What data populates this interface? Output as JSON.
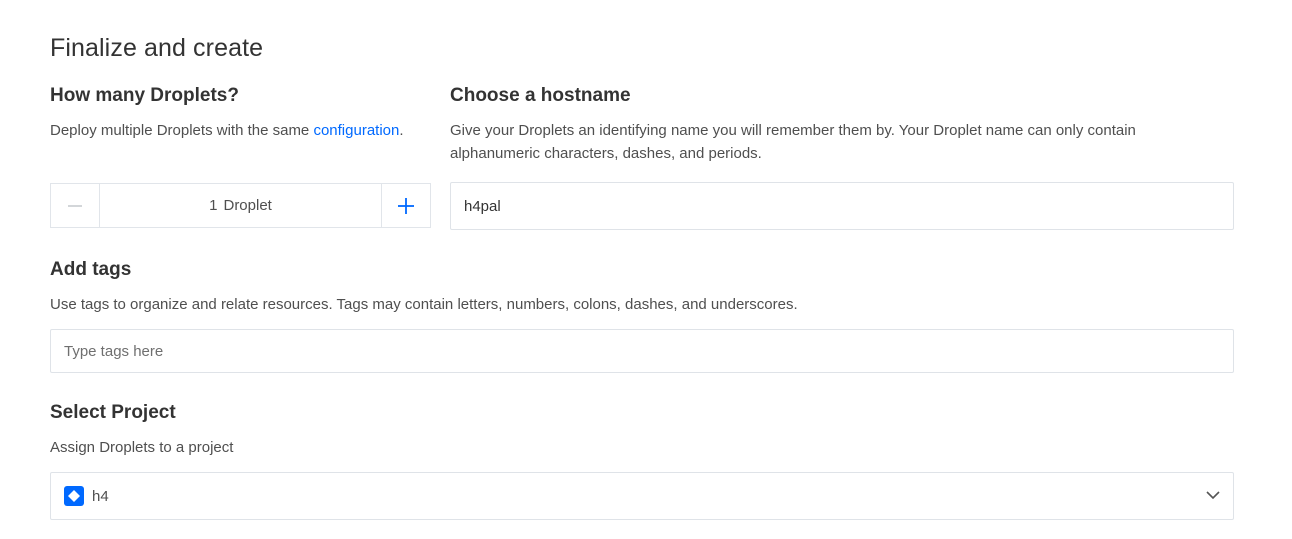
{
  "title": "Finalize and create",
  "droplets": {
    "heading": "How many Droplets?",
    "help_text": "Deploy multiple Droplets with the same ",
    "help_link": "configuration",
    "help_suffix": ".",
    "count": "1",
    "unit": "Droplet",
    "minus_icon": "minus-icon",
    "plus_icon": "plus-icon"
  },
  "hostname": {
    "heading": "Choose a hostname",
    "help_line1": "Give your Droplets an identifying name you will remember them by. Your Droplet name can only contain",
    "help_line2": "alphanumeric characters, dashes, and periods.",
    "value": "h4pal"
  },
  "tags": {
    "heading": "Add tags",
    "help_text": "Use tags to organize and relate resources. Tags may contain letters, numbers, colons, dashes, and underscores.",
    "placeholder": "Type tags here"
  },
  "project": {
    "heading": "Select Project",
    "help_text": "Assign Droplets to a project",
    "selected": "h4",
    "icon": "project-diamond-icon",
    "dropdown_icon": "chevron-down-icon"
  },
  "colors": {
    "accent": "#0069ff",
    "text": "#333333",
    "muted": "#4f4f4f",
    "border": "#dfe3e8"
  }
}
